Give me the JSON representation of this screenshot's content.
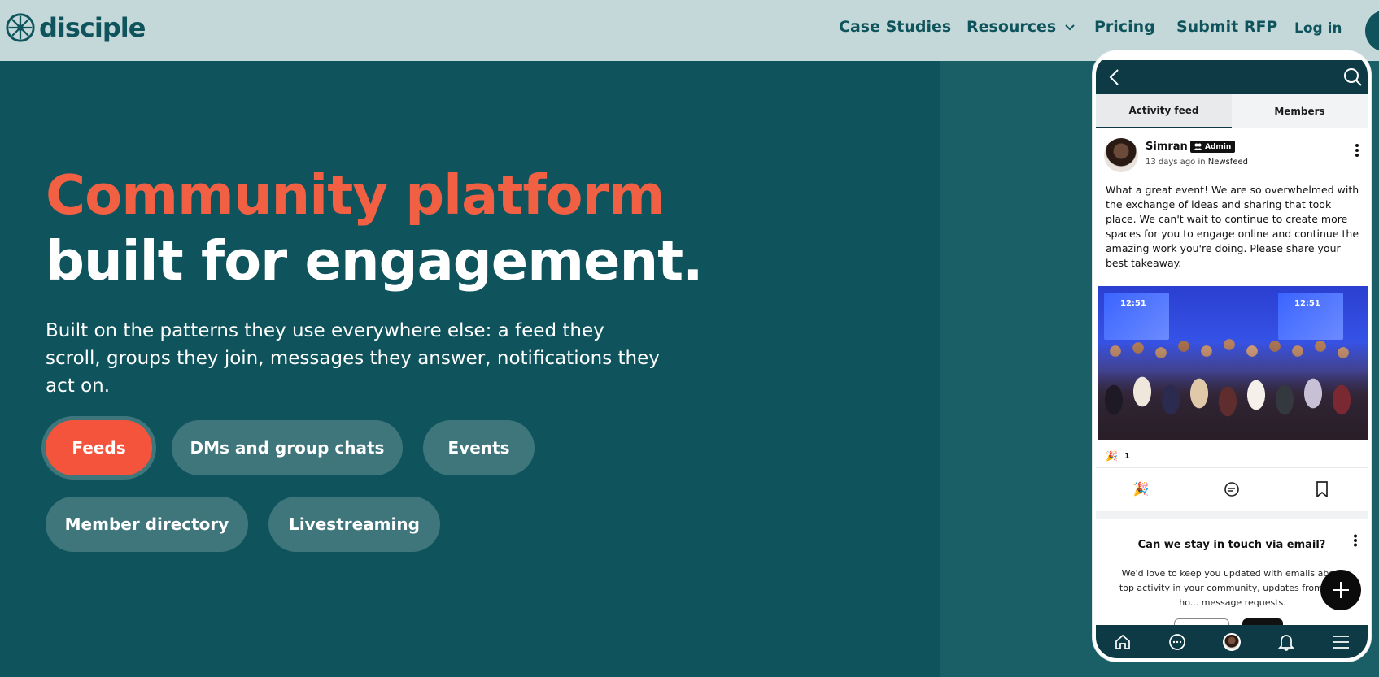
{
  "brand": {
    "name": "disciple",
    "color": "#0f545c",
    "accent": "#f26044"
  },
  "nav": {
    "links": [
      "Case Studies",
      "Resources",
      "Pricing",
      "Submit RFP"
    ],
    "login": "Log in"
  },
  "hero": {
    "title_line1": "Community platform",
    "title_line2": "built for engagement.",
    "subtitle": "Built on the patterns they use everywhere else: a feed they scroll, groups they join, messages they answer, notifications they act on."
  },
  "features": {
    "active": "Feeds",
    "items": [
      "Feeds",
      "DMs and group chats",
      "Events",
      "Member directory",
      "Livestreaming"
    ]
  },
  "phone": {
    "tabs": [
      "Activity feed",
      "Members"
    ],
    "post": {
      "author": "Simran",
      "badge": "Admin",
      "time_ago": "13 days ago",
      "in_word": "in",
      "channel": "Newsfeed",
      "body": "What a great event! We are so overwhelmed with the exchange of ideas and sharing that took place. We can't wait to continue to create more spaces for you to engage online and continue the amazing work you're doing. Please share your best takeaway.",
      "image_time_left": "12:51",
      "image_time_right": "12:51",
      "reaction_emoji": "🎉",
      "reaction_count": "1"
    },
    "email_card": {
      "title": "Can we stay in touch via email?",
      "text": "We'd love to keep you updated with emails about top activity in your community, updates from your ho... message requests."
    }
  }
}
